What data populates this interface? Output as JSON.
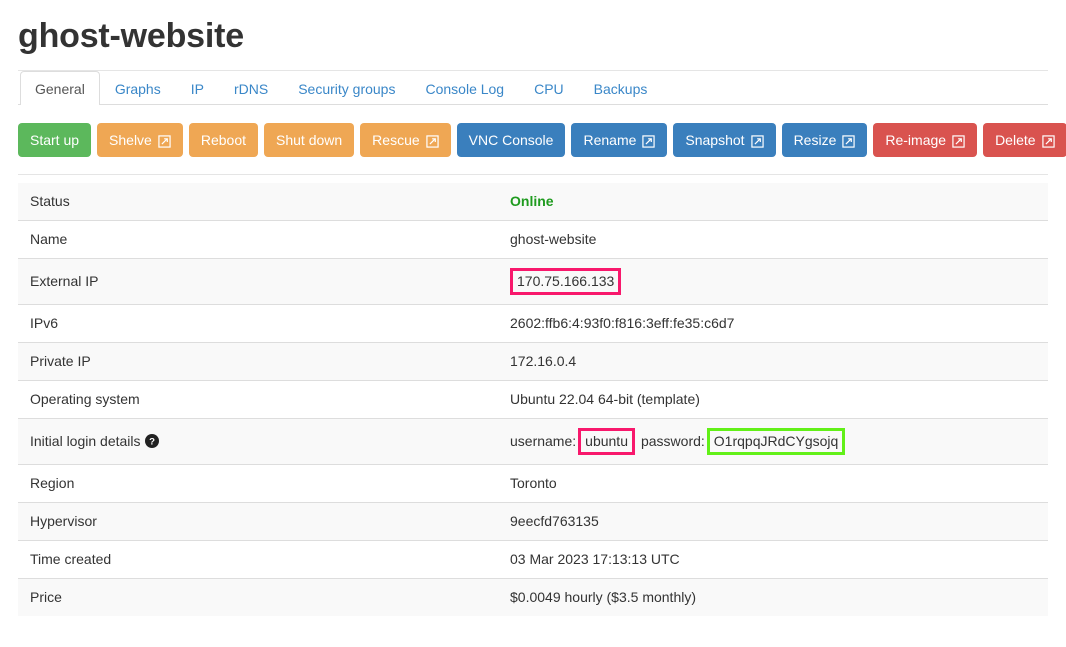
{
  "header": {
    "title": "ghost-website"
  },
  "tabs": [
    {
      "label": "General",
      "active": true
    },
    {
      "label": "Graphs",
      "active": false
    },
    {
      "label": "IP",
      "active": false
    },
    {
      "label": "rDNS",
      "active": false
    },
    {
      "label": "Security groups",
      "active": false
    },
    {
      "label": "Console Log",
      "active": false
    },
    {
      "label": "CPU",
      "active": false
    },
    {
      "label": "Backups",
      "active": false
    }
  ],
  "actions": [
    {
      "label": "Start up",
      "color": "green",
      "external": false,
      "name": "start-up-button"
    },
    {
      "label": "Shelve",
      "color": "orange",
      "external": true,
      "name": "shelve-button"
    },
    {
      "label": "Reboot",
      "color": "orange",
      "external": false,
      "name": "reboot-button"
    },
    {
      "label": "Shut down",
      "color": "orange",
      "external": false,
      "name": "shut-down-button"
    },
    {
      "label": "Rescue",
      "color": "orange",
      "external": true,
      "name": "rescue-button"
    },
    {
      "label": "VNC Console",
      "color": "blue",
      "external": false,
      "name": "vnc-console-button"
    },
    {
      "label": "Rename",
      "color": "blue",
      "external": true,
      "name": "rename-button"
    },
    {
      "label": "Snapshot",
      "color": "blue",
      "external": true,
      "name": "snapshot-button"
    },
    {
      "label": "Resize",
      "color": "blue",
      "external": true,
      "name": "resize-button"
    },
    {
      "label": "Re-image",
      "color": "red",
      "external": true,
      "name": "re-image-button"
    },
    {
      "label": "Delete",
      "color": "red",
      "external": true,
      "name": "delete-button"
    }
  ],
  "details": {
    "status_label": "Status",
    "status_value": "Online",
    "name_label": "Name",
    "name_value": "ghost-website",
    "external_ip_label": "External IP",
    "external_ip_value": "170.75.166.133",
    "ipv6_label": "IPv6",
    "ipv6_value": "2602:ffb6:4:93f0:f816:3eff:fe35:c6d7",
    "private_ip_label": "Private IP",
    "private_ip_value": "172.16.0.4",
    "os_label": "Operating system",
    "os_value": "Ubuntu 22.04 64-bit (template)",
    "login_label": "Initial login details",
    "login_username_prefix": "username:",
    "login_username_value": "ubuntu",
    "login_password_prefix": "password:",
    "login_password_value": "O1rqpqJRdCYgsojq",
    "region_label": "Region",
    "region_value": "Toronto",
    "hypervisor_label": "Hypervisor",
    "hypervisor_value": "9eecfd763135",
    "time_created_label": "Time created",
    "time_created_value": "03 Mar 2023 17:13:13 UTC",
    "price_label": "Price",
    "price_value": "$0.0049 hourly ($3.5 monthly)"
  },
  "annotations": {
    "pink_color": "#f8186c",
    "green_color": "#62f018"
  },
  "icons": {
    "external_link": "external-link-icon",
    "help": "help-circle-icon"
  },
  "colors": {
    "green_button": "#5cb85c",
    "orange_button": "#efa754",
    "blue_button": "#3a7fbd",
    "red_button": "#d9534f",
    "status_online": "#1f9b1f",
    "tab_link": "#3a87c8"
  }
}
